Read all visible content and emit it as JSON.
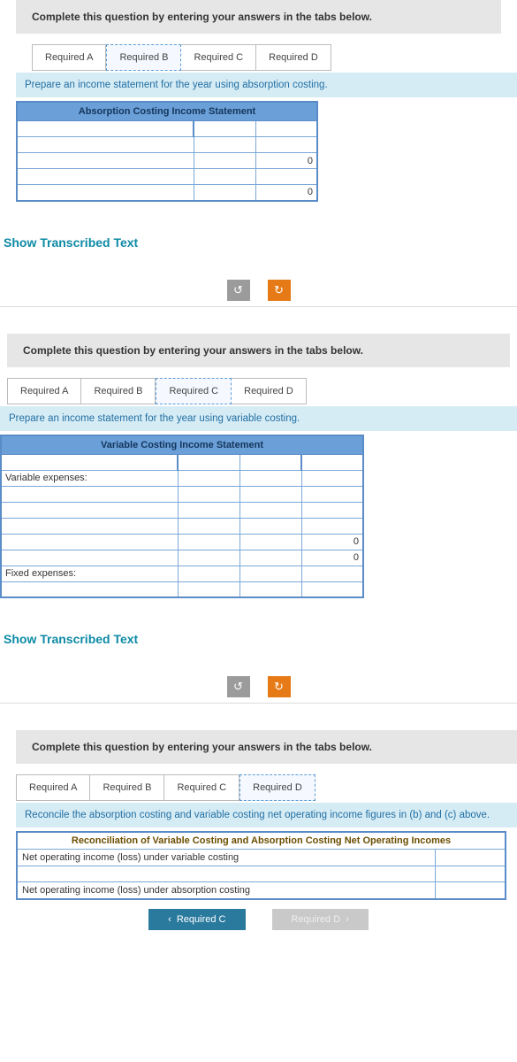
{
  "common": {
    "instruction": "Complete this question by entering your answers in the tabs below.",
    "tabs": [
      "Required A",
      "Required B",
      "Required C",
      "Required D"
    ],
    "show_transcribed": "Show Transcribed Text",
    "reset_icon": "↺",
    "redo_icon": "↻"
  },
  "block_b": {
    "active_tab": 1,
    "prompt": "Prepare an income statement for the year using absorption costing.",
    "table_title": "Absorption Costing Income Statement",
    "values": [
      "0",
      "0"
    ]
  },
  "block_c": {
    "active_tab": 2,
    "prompt": "Prepare an income statement for the year using variable costing.",
    "table_title": "Variable Costing Income Statement",
    "labels": {
      "variable": "Variable expenses:",
      "fixed": "Fixed expenses:"
    },
    "values": [
      "0",
      "0"
    ]
  },
  "block_d": {
    "active_tab": 3,
    "prompt": "Reconcile the absorption costing and variable costing net operating income figures in (b) and (c) above.",
    "table_title": "Reconciliation of Variable Costing and Absorption Costing Net Operating Incomes",
    "rows": {
      "r1": "Net operating income (loss) under variable costing",
      "r2": "Net operating income (loss) under absorption costing"
    },
    "nav": {
      "prev": "Required C",
      "next": "Required D"
    },
    "chev_left": "‹",
    "chev_right": "›"
  }
}
